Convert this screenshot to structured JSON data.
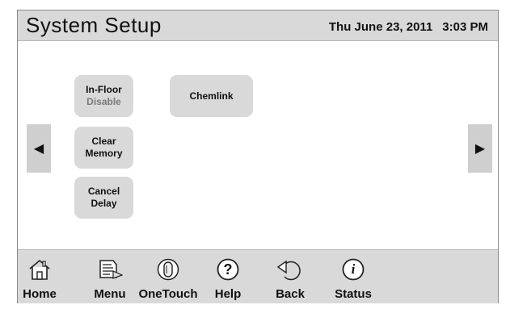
{
  "header": {
    "title": "System Setup",
    "date": "Thu June 23, 2011",
    "time": "3:03 PM"
  },
  "buttons": {
    "infloor": {
      "line1": "In-Floor",
      "line2": "Disable"
    },
    "chemlink": {
      "label": "Chemlink"
    },
    "clear_memory": {
      "line1": "Clear",
      "line2": "Memory"
    },
    "cancel_delay": {
      "line1": "Cancel",
      "line2": "Delay"
    }
  },
  "arrows": {
    "left": "◀",
    "right": "▶"
  },
  "nav": {
    "home": {
      "label": "Home",
      "icon": "home-icon"
    },
    "menu": {
      "label": "Menu",
      "icon": "menu-icon"
    },
    "onetouch": {
      "label": "OneTouch",
      "icon": "onetouch-icon"
    },
    "help": {
      "label": "Help",
      "icon": "help-icon",
      "glyph": "?"
    },
    "back": {
      "label": "Back",
      "icon": "back-icon"
    },
    "status": {
      "label": "Status",
      "icon": "status-icon",
      "glyph": "i"
    }
  },
  "colors": {
    "panel_gray": "#d9d9d9",
    "text": "#111111",
    "disabled_text": "#7a7a7a"
  }
}
